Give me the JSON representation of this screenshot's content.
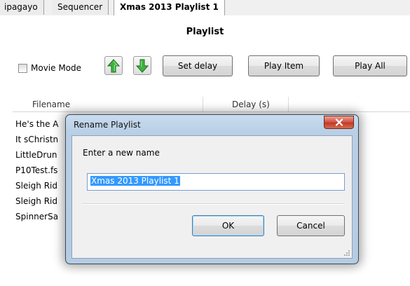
{
  "tabs": [
    {
      "label": "ipagayo",
      "active": false
    },
    {
      "label": "Sequencer",
      "active": false
    },
    {
      "label": "Xmas 2013 Playlist 1",
      "active": true
    }
  ],
  "pane": {
    "title": "Playlist",
    "toolbar": {
      "movie_mode_label": "Movie Mode",
      "movie_mode_checked": false,
      "move_up_icon": "green-up-arrow",
      "move_down_icon": "green-down-arrow",
      "set_delay_label": "Set delay",
      "play_item_label": "Play Item",
      "play_all_label": "Play All"
    },
    "list": {
      "columns": [
        "Filename",
        "Delay (s)"
      ],
      "rows": [
        {
          "filename": "He's the A"
        },
        {
          "filename": "It sChristn"
        },
        {
          "filename": "LittleDrun"
        },
        {
          "filename": "P10Test.fs"
        },
        {
          "filename": "Sleigh Rid"
        },
        {
          "filename": "Sleigh Rid"
        },
        {
          "filename": "SpinnerSa"
        }
      ]
    }
  },
  "dialog": {
    "title": "Rename Playlist",
    "close_icon": "close-x",
    "prompt": "Enter a new name",
    "input_value": "Xmas 2013 Playlist 1",
    "ok_label": "OK",
    "cancel_label": "Cancel"
  },
  "colors": {
    "selection": "#3399ff",
    "dialog_frame": "#b9cfe6",
    "close_button": "#c94a36",
    "arrow_green": "#2e9e2e"
  }
}
